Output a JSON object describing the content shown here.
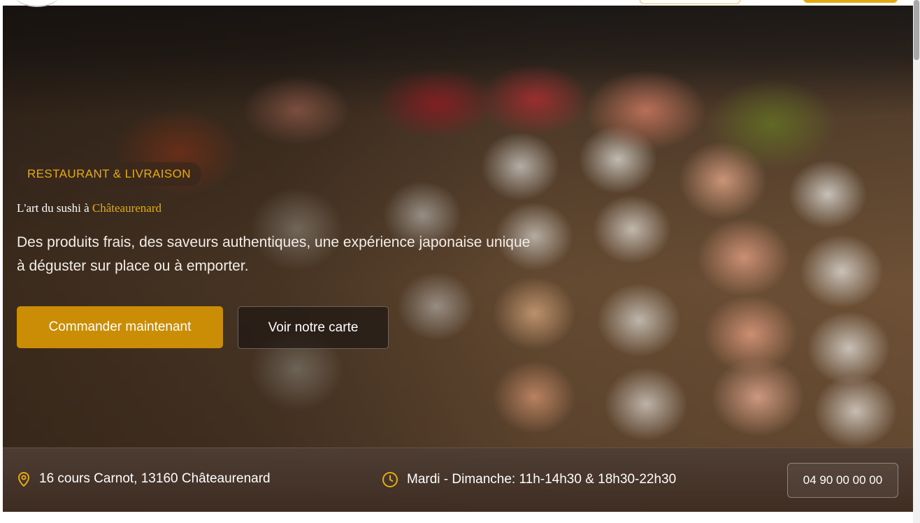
{
  "hero": {
    "badge": "RESTAURANT & LIVRAISON",
    "subtitle_prefix": "L'art du sushi à ",
    "subtitle_accent": "Châteaurenard",
    "description": "Des produits frais, des saveurs authentiques, une expérience japonaise unique à déguster sur place ou à emporter.",
    "primary_button": "Commander maintenant",
    "secondary_button": "Voir notre carte"
  },
  "info_bar": {
    "address": "16 cours Carnot, 13160 Châteaurenard",
    "hours": "Mardi - Dimanche: 11h-14h30 & 18h30-22h30",
    "phone": "04 90 00 00 00",
    "address_icon": "map-pin-icon",
    "hours_icon": "clock-icon"
  },
  "colors": {
    "accent": "#e5ac0f",
    "primary_button_bg": "#ca8d05",
    "secondary_button_bg": "#2a201a",
    "info_bar_bg": "#4a3a30",
    "header_button": "#e3a90e"
  }
}
